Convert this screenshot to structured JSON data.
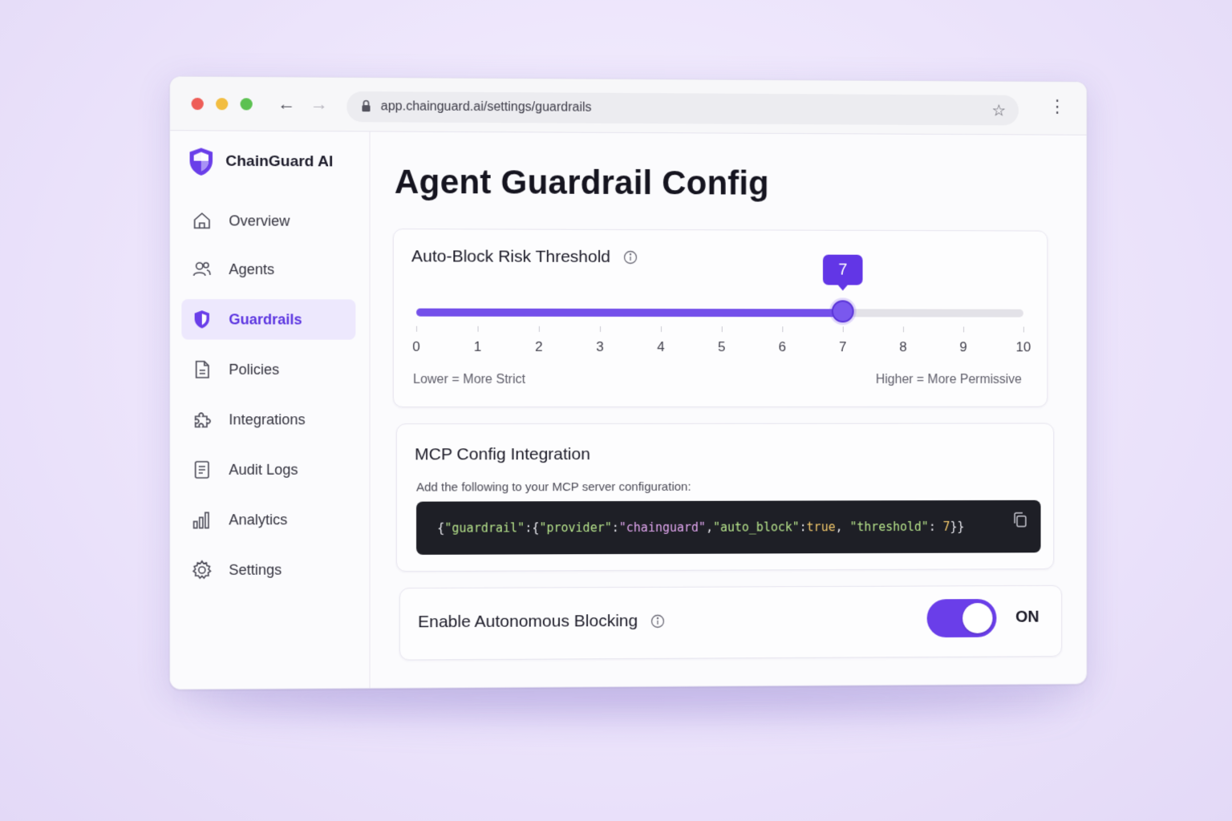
{
  "browser": {
    "url": "app.chainguard.ai/settings/guardrails"
  },
  "sidebar": {
    "brand": "ChainGuard AI",
    "items": [
      {
        "label": "Overview",
        "icon": "home-icon",
        "active": false
      },
      {
        "label": "Agents",
        "icon": "users-icon",
        "active": false
      },
      {
        "label": "Guardrails",
        "icon": "shield-icon",
        "active": true
      },
      {
        "label": "Policies",
        "icon": "document-icon",
        "active": false
      },
      {
        "label": "Integrations",
        "icon": "puzzle-icon",
        "active": false
      },
      {
        "label": "Audit Logs",
        "icon": "list-icon",
        "active": false
      },
      {
        "label": "Analytics",
        "icon": "bar-chart-icon",
        "active": false
      },
      {
        "label": "Settings",
        "icon": "gear-icon",
        "active": false
      }
    ]
  },
  "main": {
    "title": "Agent Guardrail Config",
    "threshold": {
      "title": "Auto-Block Risk Threshold",
      "min": 0,
      "max": 10,
      "value": 7,
      "value_label": "7",
      "ticks": [
        "0",
        "1",
        "2",
        "3",
        "4",
        "5",
        "6",
        "7",
        "8",
        "9",
        "10"
      ],
      "low_note": "Lower = More Strict",
      "high_note": "Higher = More Permissive"
    },
    "mcp": {
      "title": "MCP Config Integration",
      "subtitle": "Add the following to your MCP server configuration:",
      "code": {
        "p1": "{",
        "k1": "\"guardrail\"",
        "p2": ":{",
        "k2": "\"provider\"",
        "p3": ":",
        "v2": "\"chainguard\"",
        "p4": ",",
        "k3": "\"auto_block\"",
        "p5": ":",
        "v3": "true",
        "p6": ", ",
        "k4": "\"threshold\"",
        "p7": ": ",
        "v4": "7",
        "p8": "}}"
      }
    },
    "autonomous": {
      "label": "Enable Autonomous Blocking",
      "enabled": true,
      "state_label": "ON"
    }
  },
  "colors": {
    "accent": "#6236e6",
    "active_bg": "#ede8fd",
    "code_bg": "#1e1f26"
  }
}
